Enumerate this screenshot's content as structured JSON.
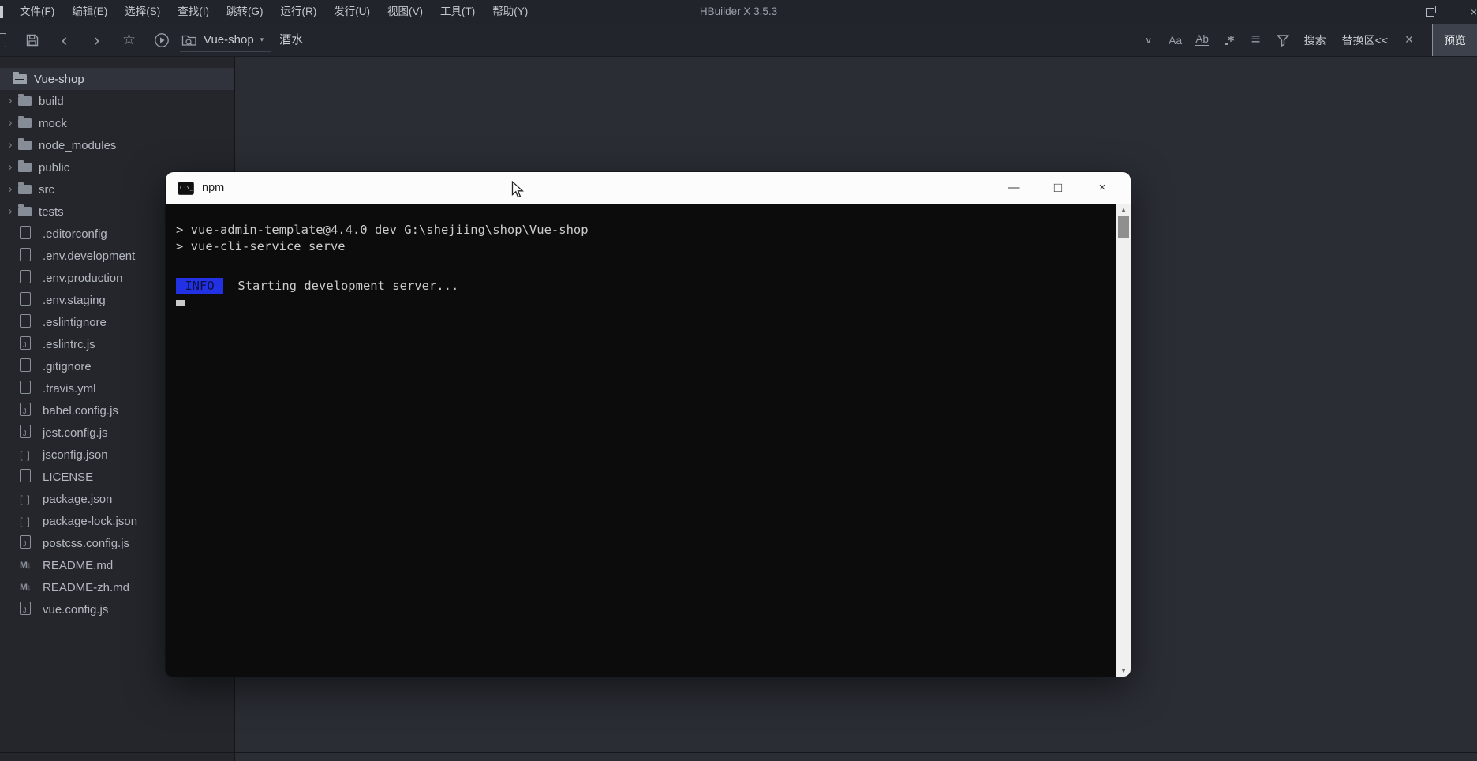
{
  "app": {
    "title": "HBuilder X 3.5.3"
  },
  "menu": {
    "items": [
      "文件(F)",
      "编辑(E)",
      "选择(S)",
      "查找(I)",
      "跳转(G)",
      "运行(R)",
      "发行(U)",
      "视图(V)",
      "工具(T)",
      "帮助(Y)"
    ]
  },
  "toolbar": {
    "project": "Vue-shop",
    "active_tab": "酒水",
    "font_label": "Aa",
    "replace_style_label": "Ab",
    "search": "搜索",
    "replace_area": "替换区<<",
    "preview": "预览"
  },
  "sidebar": {
    "root": "Vue-shop",
    "items": [
      {
        "label": "build",
        "kind": "folder"
      },
      {
        "label": "mock",
        "kind": "folder"
      },
      {
        "label": "node_modules",
        "kind": "folder"
      },
      {
        "label": "public",
        "kind": "folder"
      },
      {
        "label": "src",
        "kind": "folder"
      },
      {
        "label": "tests",
        "kind": "folder"
      },
      {
        "label": ".editorconfig",
        "kind": "file"
      },
      {
        "label": ".env.development",
        "kind": "file"
      },
      {
        "label": ".env.production",
        "kind": "file"
      },
      {
        "label": ".env.staging",
        "kind": "file"
      },
      {
        "label": ".eslintignore",
        "kind": "file"
      },
      {
        "label": ".eslintrc.js",
        "kind": "js"
      },
      {
        "label": ".gitignore",
        "kind": "file"
      },
      {
        "label": ".travis.yml",
        "kind": "file"
      },
      {
        "label": "babel.config.js",
        "kind": "js"
      },
      {
        "label": "jest.config.js",
        "kind": "js"
      },
      {
        "label": "jsconfig.json",
        "kind": "json"
      },
      {
        "label": "LICENSE",
        "kind": "file"
      },
      {
        "label": "package.json",
        "kind": "json"
      },
      {
        "label": "package-lock.json",
        "kind": "json"
      },
      {
        "label": "postcss.config.js",
        "kind": "js"
      },
      {
        "label": "README.md",
        "kind": "md"
      },
      {
        "label": "README-zh.md",
        "kind": "md"
      },
      {
        "label": "vue.config.js",
        "kind": "js"
      }
    ]
  },
  "terminal": {
    "title": "npm",
    "lines": [
      {
        "type": "cmd",
        "text": "> vue-admin-template@4.4.0 dev G:\\shejiing\\shop\\Vue-shop"
      },
      {
        "type": "cmd",
        "text": "> vue-cli-service serve"
      },
      {
        "type": "blank"
      },
      {
        "type": "info",
        "badge": " INFO ",
        "text": " Starting development server..."
      },
      {
        "type": "cursor"
      }
    ],
    "colors": {
      "info_bg": "#2331e4",
      "info_fg": "#0b1140"
    }
  },
  "icons": {
    "minimize": "—",
    "close": "×",
    "term_min": "—",
    "term_max": "□",
    "term_close": "×",
    "back": "‹",
    "forward": "›",
    "star": "☆",
    "chevron_down": "∨",
    "align_lines": "≡",
    "clear": "×",
    "caret_down": "▾",
    "tree_chevron": "›",
    "json_brackets": "[ ]",
    "md_mark": "M↓",
    "scroll_up": "▲",
    "scroll_down": "▼",
    "console_prompt": "C:\\_"
  }
}
